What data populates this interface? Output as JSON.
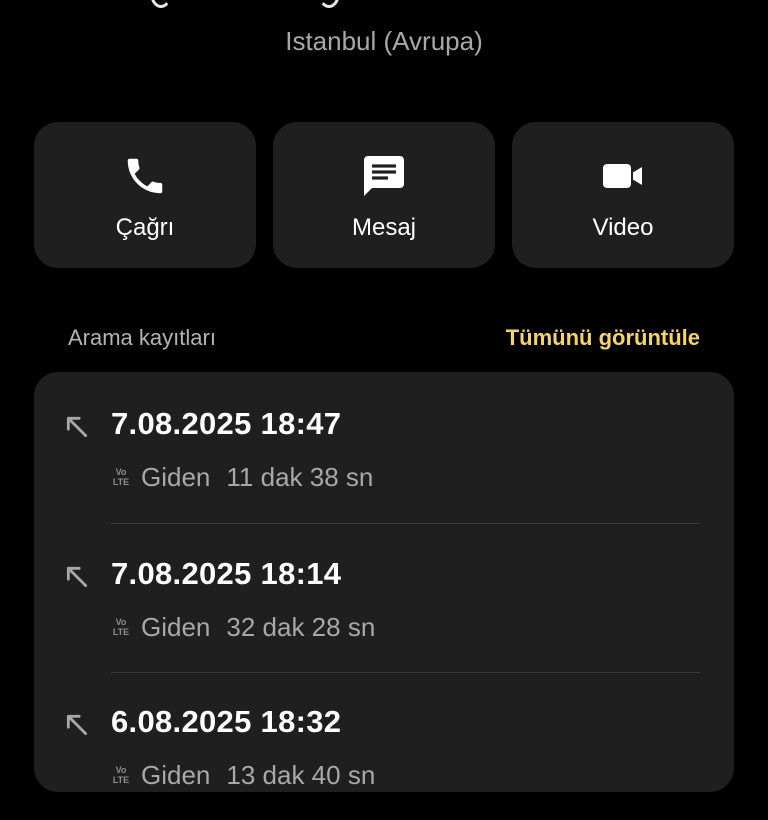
{
  "contact": {
    "location": "Istanbul (Avrupa)"
  },
  "actions": [
    {
      "label": "Çağrı",
      "icon": "phone-icon"
    },
    {
      "label": "Mesaj",
      "icon": "message-icon"
    },
    {
      "label": "Video",
      "icon": "video-icon"
    }
  ],
  "call_log": {
    "title": "Arama kayıtları",
    "view_all": "Tümünü görüntüle",
    "entries": [
      {
        "datetime": "7.08.2025 18:47",
        "badge_top": "Vo",
        "badge_bottom": "LTE",
        "type": "Giden",
        "duration": "11 dak 38 sn",
        "icon": "outgoing-call-icon"
      },
      {
        "datetime": "7.08.2025 18:14",
        "badge_top": "Vo",
        "badge_bottom": "LTE",
        "type": "Giden",
        "duration": "32 dak 28 sn",
        "icon": "outgoing-call-icon"
      },
      {
        "datetime": "6.08.2025 18:32",
        "badge_top": "Vo",
        "badge_bottom": "LTE",
        "type": "Giden",
        "duration": "13 dak 40 sn",
        "icon": "outgoing-call-icon"
      }
    ]
  },
  "colors": {
    "background": "#000000",
    "card": "#1f1f1f",
    "accent": "#f3d36a",
    "secondary_text": "#a8a8a8"
  }
}
